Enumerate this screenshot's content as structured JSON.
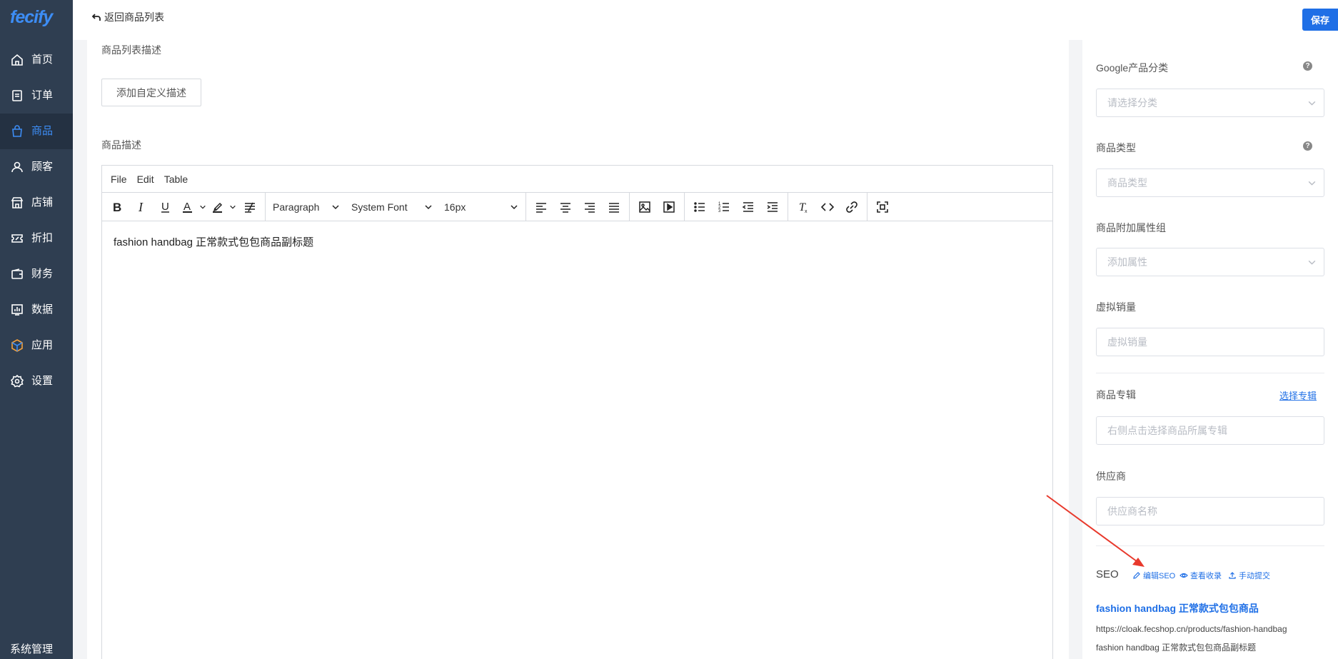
{
  "app": {
    "logo_text": "fecify"
  },
  "sidebar": {
    "items": [
      {
        "label": "首页",
        "icon": "home-icon"
      },
      {
        "label": "订单",
        "icon": "order-icon"
      },
      {
        "label": "商品",
        "icon": "bag-icon",
        "active": true
      },
      {
        "label": "顾客",
        "icon": "user-icon"
      },
      {
        "label": "店铺",
        "icon": "store-icon"
      },
      {
        "label": "折扣",
        "icon": "ticket-icon"
      },
      {
        "label": "财务",
        "icon": "wallet-icon"
      },
      {
        "label": "数据",
        "icon": "chart-icon"
      },
      {
        "label": "应用",
        "icon": "cube-icon"
      },
      {
        "label": "设置",
        "icon": "gear-icon"
      }
    ],
    "bottom_label": "系统管理"
  },
  "header": {
    "back_label": "返回商品列表",
    "save_label": "保存"
  },
  "main": {
    "list_desc_label": "商品列表描述",
    "add_custom_desc_label": "添加自定义描述",
    "product_desc_label": "商品描述",
    "editor": {
      "menus": [
        "File",
        "Edit",
        "Table"
      ],
      "block_format": "Paragraph",
      "font_family": "System Font",
      "font_size": "16px",
      "content": "fashion handbag 正常款式包包商品副标题"
    }
  },
  "right": {
    "google_category": {
      "label": "Google产品分类",
      "placeholder": "请选择分类"
    },
    "product_type": {
      "label": "商品类型",
      "placeholder": "商品类型"
    },
    "attribute_group": {
      "label": "商品附加属性组",
      "placeholder": "添加属性"
    },
    "virtual_sales": {
      "label": "虚拟销量",
      "placeholder": "虚拟销量"
    },
    "collection": {
      "label": "商品专辑",
      "link": "选择专辑",
      "placeholder": "右侧点击选择商品所属专辑"
    },
    "supplier": {
      "label": "供应商",
      "placeholder": "供应商名称"
    },
    "seo": {
      "label": "SEO",
      "edit_label": "编辑SEO",
      "view_label": "查看收录",
      "submit_label": "手动提交",
      "title": "fashion handbag 正常款式包包商品",
      "url": "https://cloak.fecshop.cn/products/fashion-handbag",
      "description": "fashion handbag 正常款式包包商品副标题"
    }
  },
  "colors": {
    "sidebar_bg": "#2f3e51",
    "accent": "#1f6fe6",
    "annotation_arrow": "#e8392c"
  }
}
